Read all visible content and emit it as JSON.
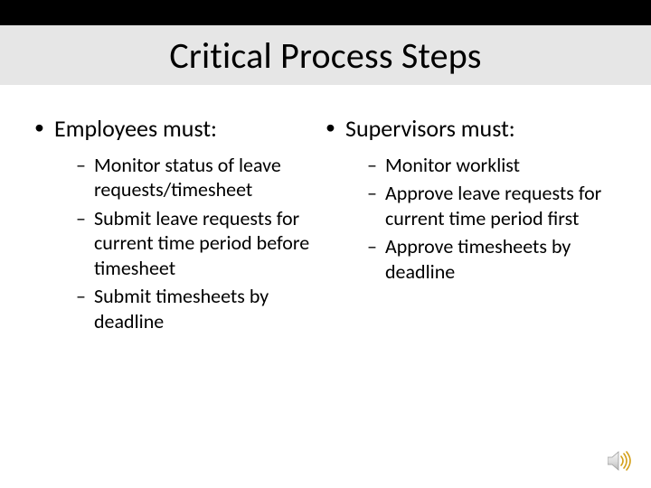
{
  "title": "Critical Process Steps",
  "left": {
    "heading": "Employees must:",
    "items": [
      "Monitor status of leave requests/timesheet",
      "Submit leave requests for current time period before timesheet",
      "Submit timesheets by deadline"
    ]
  },
  "right": {
    "heading": "Supervisors must:",
    "items": [
      "Monitor worklist",
      "Approve leave requests for current time period first",
      "Approve timesheets by deadline"
    ]
  }
}
